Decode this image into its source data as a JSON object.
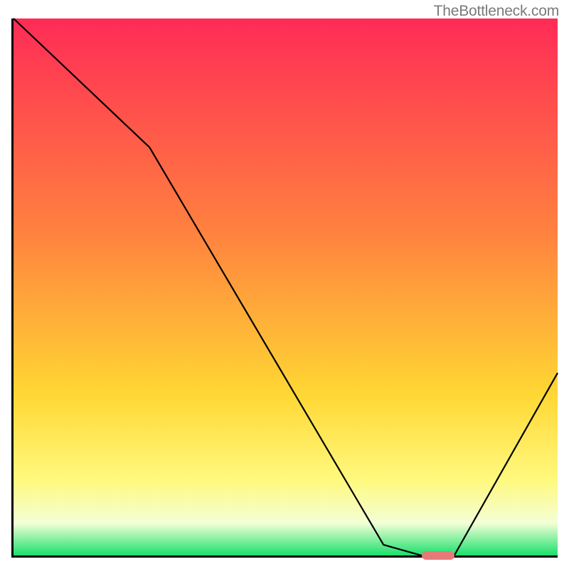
{
  "watermark": "TheBottleneck.com",
  "colors": {
    "top": "#ff2b56",
    "mid_upper": "#ff823f",
    "mid": "#ffd733",
    "mid_lower": "#fff97e",
    "pale": "#f3ffd6",
    "bottom": "#19e06b",
    "axis": "#000000",
    "curve": "#000000",
    "marker": "#e67a78",
    "watermark_text": "#7a7a7a"
  },
  "chart_data": {
    "type": "line",
    "title": "",
    "xlabel": "",
    "ylabel": "",
    "xlim": [
      0,
      100
    ],
    "ylim": [
      0,
      100
    ],
    "x": [
      0,
      25,
      68,
      75,
      81,
      100
    ],
    "values": [
      100,
      76,
      2,
      0,
      0,
      34
    ],
    "minimum_band": {
      "x_start": 75,
      "x_end": 81,
      "y": 0
    },
    "background_gradient_stops": [
      {
        "pct": 0,
        "color": "#ff2b56"
      },
      {
        "pct": 40,
        "color": "#ff823f"
      },
      {
        "pct": 70,
        "color": "#ffd733"
      },
      {
        "pct": 86,
        "color": "#fff97e"
      },
      {
        "pct": 94,
        "color": "#f3ffd6"
      },
      {
        "pct": 100,
        "color": "#19e06b"
      }
    ]
  }
}
